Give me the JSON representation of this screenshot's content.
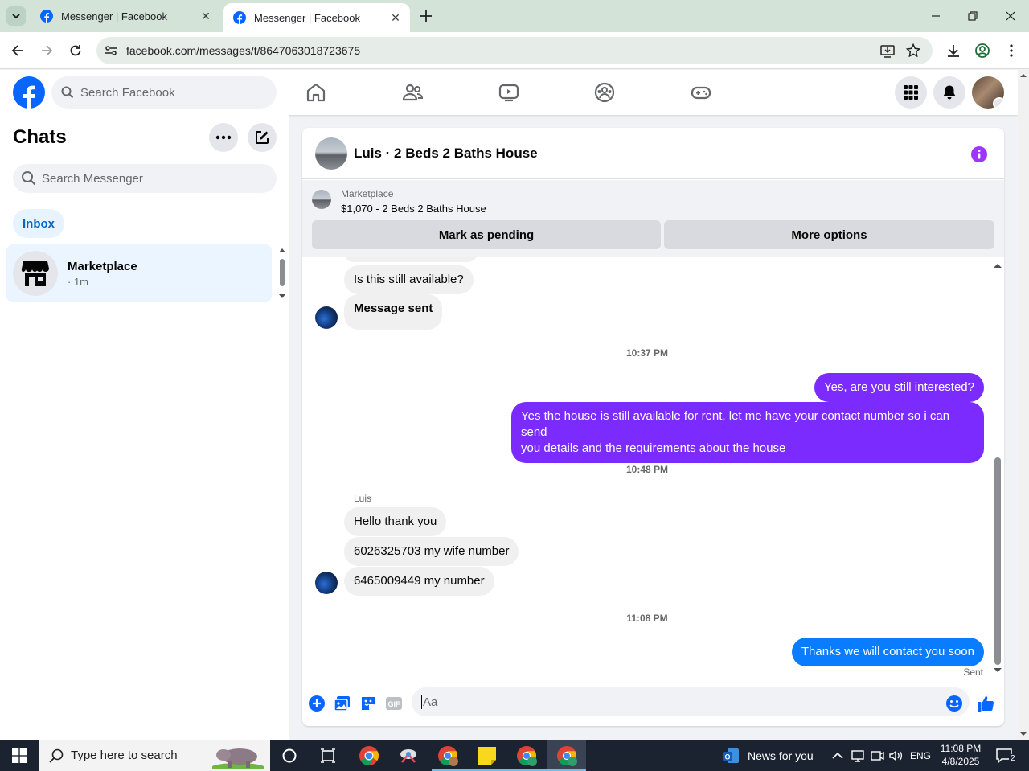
{
  "browser": {
    "tabs": [
      {
        "title": "Messenger | Facebook",
        "active": false
      },
      {
        "title": "Messenger | Facebook",
        "active": true
      }
    ],
    "url": "facebook.com/messages/t/8647063018723675"
  },
  "fb_nav": {
    "search_placeholder": "Search Facebook"
  },
  "sidebar": {
    "title": "Chats",
    "search_placeholder": "Search Messenger",
    "filter_label": "Inbox",
    "chats": [
      {
        "name": "Marketplace",
        "time": "· 1m"
      }
    ]
  },
  "conversation": {
    "title": "Luis · 2 Beds 2 Baths House",
    "marketplace_label": "Marketplace",
    "listing": "$1,070 - 2 Beds 2 Baths House",
    "mark_pending_label": "Mark as pending",
    "more_options_label": "More options",
    "messages": {
      "m1": "Is this still available?",
      "m2": "Message sent",
      "ts1": "10:37 PM",
      "m3": "Yes, are you still interested?",
      "m4_line1": "Yes the house is still available for rent, let me have your contact number so i can send",
      "m4_line2": "you details and the requirements about the house",
      "ts2": "10:48 PM",
      "sender": "Luis",
      "m5": "Hello thank you",
      "m6": "6026325703 my wife number",
      "m7": "6465009449 my number",
      "ts3": "11:08 PM",
      "m8": "Thanks we will contact you soon",
      "status": "Sent"
    },
    "composer_placeholder": "Aa"
  },
  "taskbar": {
    "search_placeholder": "Type here to search",
    "news": "News for you",
    "lang": "ENG",
    "time": "11:08 PM",
    "date": "4/8/2025",
    "notifications": "2"
  },
  "colors": {
    "fb_blue": "#0866ff",
    "outgoing_purple": "#7c2bff",
    "outgoing_blue": "#0a7cff",
    "info_purple": "#a033ff"
  }
}
